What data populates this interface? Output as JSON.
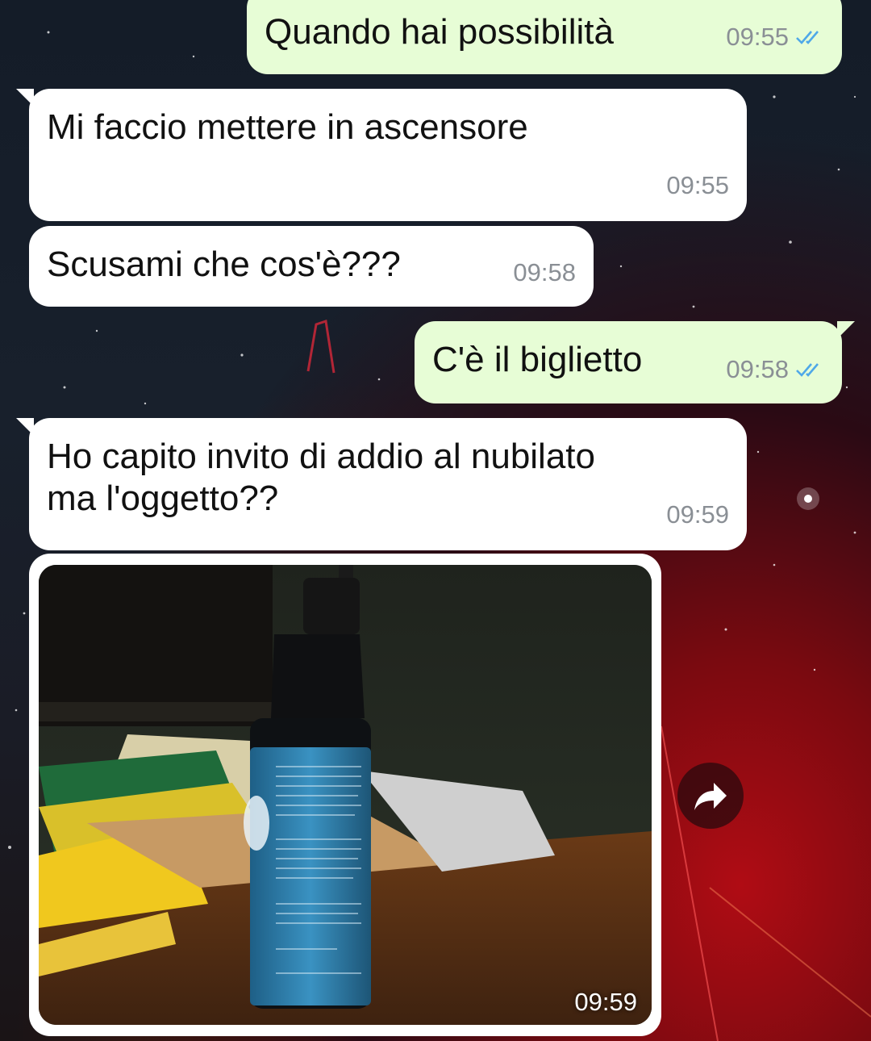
{
  "messages": [
    {
      "text": "Quando hai possibilità",
      "time": "09:55",
      "direction": "outgoing",
      "status": "read"
    },
    {
      "text": "Mi faccio mettere in ascensore",
      "time": "09:55",
      "direction": "incoming"
    },
    {
      "text": "Scusami che cos'è???",
      "time": "09:58",
      "direction": "incoming"
    },
    {
      "text": "C'è il biglietto",
      "time": "09:58",
      "direction": "outgoing",
      "status": "read"
    },
    {
      "text": "Ho capito invito di addio al nubilato\nma l'oggetto??",
      "time": "09:59",
      "direction": "incoming"
    }
  ],
  "media": {
    "time": "09:59",
    "type": "photo"
  },
  "icons": {
    "read_receipt": "double-check-icon",
    "share": "forward-arrow-icon"
  },
  "colors": {
    "outgoing_bubble": "#e7fdd6",
    "incoming_bubble": "#ffffff",
    "read_tick": "#4fa8e8",
    "timestamp": "#8a8f95"
  }
}
